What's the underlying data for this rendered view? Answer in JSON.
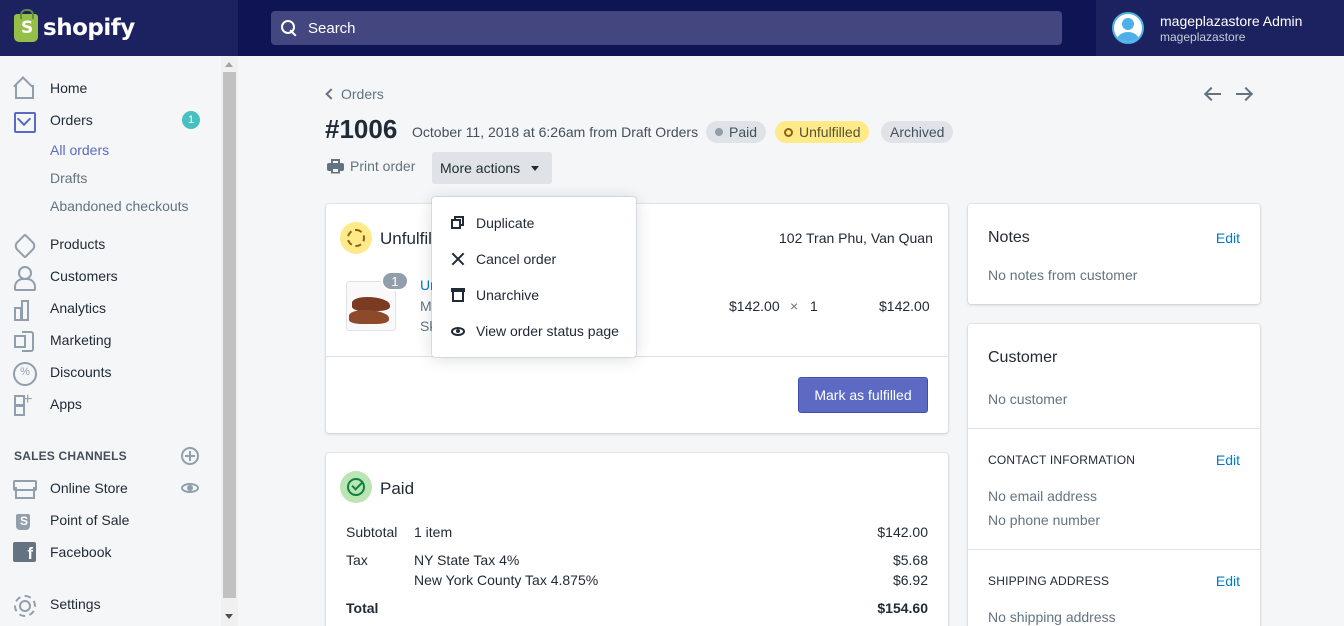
{
  "brand": {
    "name": "shopify"
  },
  "search": {
    "placeholder": "Search"
  },
  "user": {
    "name": "mageplazastore Admin",
    "store": "mageplazastore"
  },
  "sidebar": {
    "items": [
      {
        "label": "Home",
        "icon": "home-icon"
      },
      {
        "label": "Orders",
        "icon": "orders-icon",
        "badge": "1"
      },
      {
        "label": "Products",
        "icon": "tag-icon"
      },
      {
        "label": "Customers",
        "icon": "person-icon"
      },
      {
        "label": "Analytics",
        "icon": "chart-icon"
      },
      {
        "label": "Marketing",
        "icon": "megaphone-icon"
      },
      {
        "label": "Discounts",
        "icon": "discount-icon"
      },
      {
        "label": "Apps",
        "icon": "apps-icon"
      }
    ],
    "order_subitems": [
      "All orders",
      "Drafts",
      "Abandoned checkouts"
    ],
    "channels_heading": "SALES CHANNELS",
    "channels": [
      {
        "label": "Online Store",
        "icon": "store-icon"
      },
      {
        "label": "Point of Sale",
        "icon": "pos-icon"
      },
      {
        "label": "Facebook",
        "icon": "facebook-icon"
      }
    ],
    "settings": "Settings"
  },
  "breadcrumb": {
    "label": "Orders"
  },
  "order": {
    "number": "#1006",
    "meta": "October 11, 2018 at 6:26am from Draft Orders",
    "badges": {
      "paid": "Paid",
      "unfulfilled": "Unfulfilled",
      "archived": "Archived"
    }
  },
  "actions": {
    "print": "Print order",
    "more": "More actions"
  },
  "dropdown": {
    "items": [
      {
        "label": "Duplicate",
        "icon": "duplicate-icon"
      },
      {
        "label": "Cancel order",
        "icon": "close-icon"
      },
      {
        "label": "Unarchive",
        "icon": "archive-icon"
      },
      {
        "label": "View order status page",
        "icon": "eye-icon"
      }
    ]
  },
  "unfulfilled": {
    "title": "Unfulfilled",
    "location": "102 Tran Phu, Van Quan",
    "line_item": {
      "qty_badge": "1",
      "name_visible": "Un",
      "variant_visible": "M",
      "sku_visible": "Sk",
      "unit_price": "$142.00",
      "times": "×",
      "qty": "1",
      "total": "$142.00"
    },
    "button": "Mark as fulfilled"
  },
  "paid": {
    "title": "Paid",
    "rows": [
      {
        "label": "Subtotal",
        "desc": "1 item",
        "value": "$142.00"
      },
      {
        "label": "Tax",
        "desc": "NY State Tax 4%",
        "value": "$5.68"
      },
      {
        "label": "",
        "desc": "New York County Tax 4.875%",
        "value": "$6.92"
      }
    ],
    "total": {
      "label": "Total",
      "value": "$154.60"
    }
  },
  "notes": {
    "title": "Notes",
    "edit": "Edit",
    "text": "No notes from customer"
  },
  "customer": {
    "title": "Customer",
    "text": "No customer",
    "contact_heading": "CONTACT INFORMATION",
    "contact_edit": "Edit",
    "email": "No email address",
    "phone": "No phone number",
    "shipping_heading": "SHIPPING ADDRESS",
    "shipping_edit": "Edit",
    "shipping": "No shipping address"
  },
  "colors": {
    "topbar": "#1c2260",
    "accent": "#5c6ac4",
    "link": "#007ace",
    "unfulfilled_badge": "#ffea8a",
    "paid_circle": "#bbe5b3"
  }
}
